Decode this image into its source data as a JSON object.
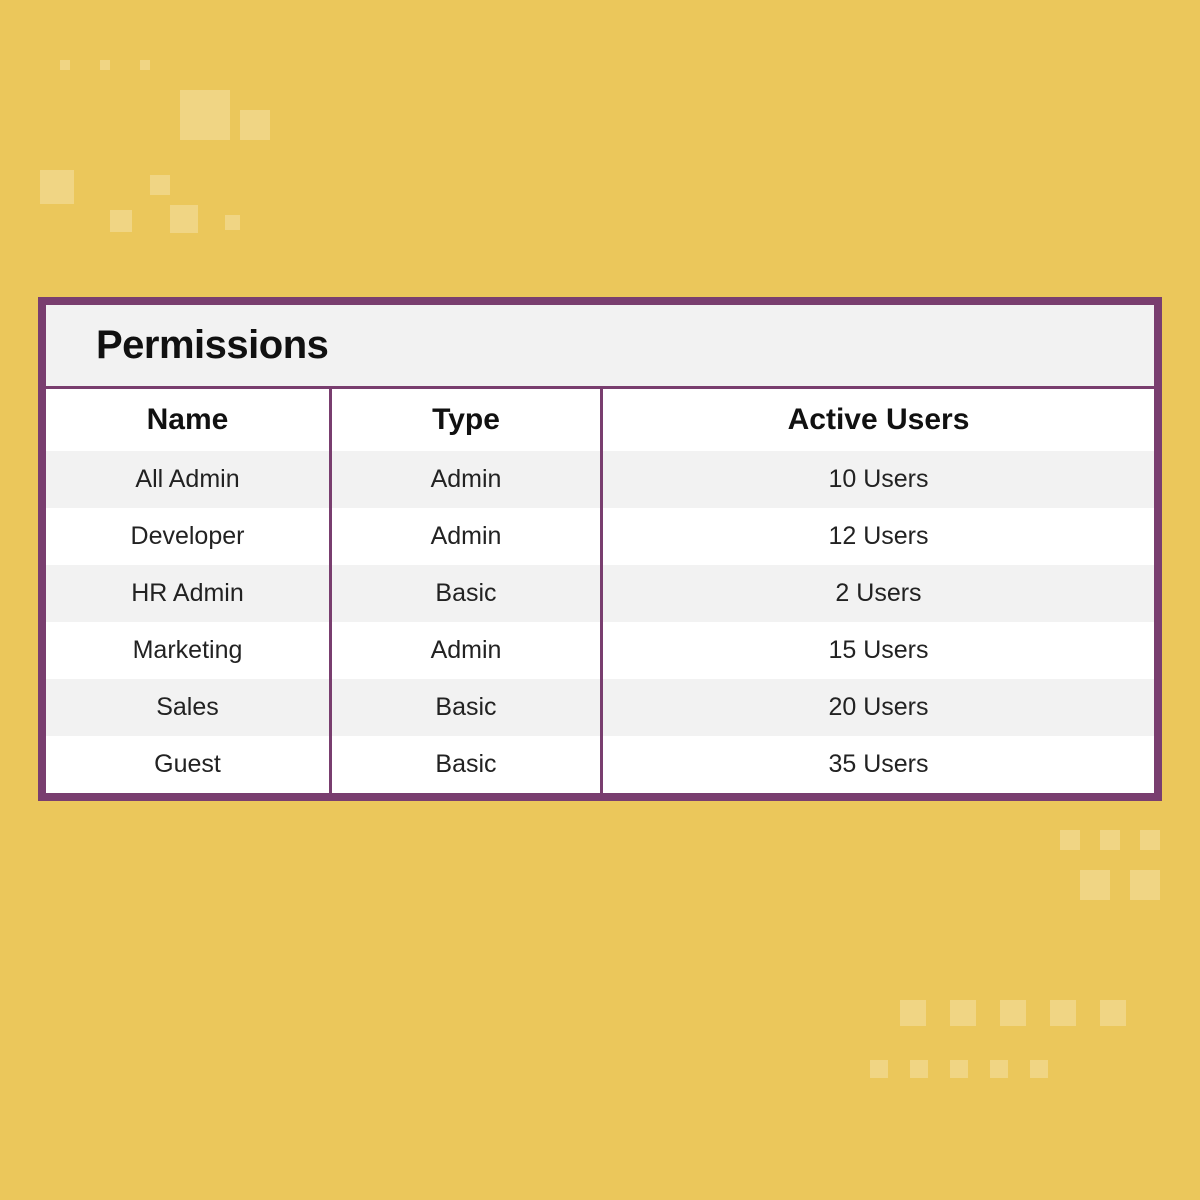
{
  "colors": {
    "background": "#ebc75b",
    "border": "#793e6f",
    "header_bg": "#f2f2f2",
    "row_alt_bg": "#f2f2f2"
  },
  "panel": {
    "title": "Permissions",
    "columns": {
      "name": "Name",
      "type": "Type",
      "active_users": "Active Users"
    },
    "rows": [
      {
        "name": "All Admin",
        "type": "Admin",
        "active_users": "10 Users"
      },
      {
        "name": "Developer",
        "type": "Admin",
        "active_users": "12 Users"
      },
      {
        "name": "HR Admin",
        "type": "Basic",
        "active_users": "2 Users"
      },
      {
        "name": "Marketing",
        "type": "Admin",
        "active_users": "15 Users"
      },
      {
        "name": "Sales",
        "type": "Basic",
        "active_users": "20 Users"
      },
      {
        "name": "Guest",
        "type": "Basic",
        "active_users": "35 Users"
      }
    ]
  }
}
